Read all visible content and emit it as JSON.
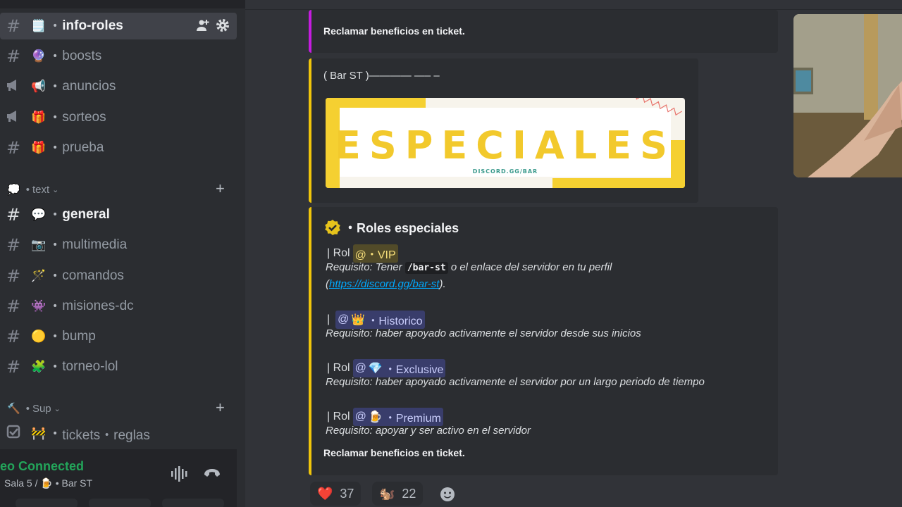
{
  "sidebar": {
    "channels_top": [
      {
        "label": "info-roles",
        "emoji": "🗒️",
        "icon": "hash",
        "active": true
      },
      {
        "label": "boosts",
        "emoji": "🔮",
        "icon": "hash"
      },
      {
        "label": "anuncios",
        "emoji": "📢",
        "icon": "megaphone"
      },
      {
        "label": "sorteos",
        "emoji": "🎁",
        "icon": "megaphone"
      },
      {
        "label": "prueba",
        "emoji": "🎁",
        "icon": "hash-thread"
      }
    ],
    "category_text": {
      "emoji": "💭",
      "label": "text"
    },
    "channels_text": [
      {
        "label": "general",
        "emoji": "💬",
        "icon": "hash",
        "bold": true
      },
      {
        "label": "multimedia",
        "emoji": "📷",
        "icon": "hash"
      },
      {
        "label": "comandos",
        "emoji": "🪄",
        "icon": "hash"
      },
      {
        "label": "misiones-dc",
        "emoji": "👾",
        "icon": "hash"
      },
      {
        "label": "bump",
        "emoji": "🟡",
        "icon": "hash-thread"
      },
      {
        "label": "torneo-lol",
        "emoji": "🧩",
        "icon": "hash-thread"
      }
    ],
    "category_sup": {
      "emoji": "🔨",
      "label": "Sup"
    },
    "channel_tickets": {
      "label": "tickets・reglas",
      "emoji": "🚧",
      "icon": "checkbox"
    },
    "voice": {
      "status": "eo Connected",
      "location": "Sala 5 /",
      "server": "Bar ST",
      "server_emoji": "🍺"
    }
  },
  "messages": {
    "top_embed_footer": "Reclamar beneficios en ticket.",
    "bar_embed_title": "( Bar ST )———— —– –",
    "banner": {
      "title": "ESPECIALES",
      "sub": "DISCORD.GG/BAR"
    },
    "roles_embed": {
      "title": "・Roles especiales",
      "title_emoji": "✅",
      "rol_word": "| Rol",
      "bar_only": "|",
      "vip": {
        "mention": "@・VIP",
        "req_pre": "Requisito: Tener",
        "req_code": "/bar-st",
        "req_post": "o el enlace del servidor en tu perfil",
        "link_open": "(",
        "link": "https://discord.gg/bar-st",
        "link_close": ")."
      },
      "historico": {
        "mention_emoji": "👑",
        "mention": "・Historico",
        "req": "Requisito: haber apoyado activamente el servidor desde sus inicios"
      },
      "exclusive": {
        "mention_emoji": "💎",
        "mention": "・Exclusive",
        "req": "Requisito: haber apoyado activamente el servidor por un largo periodo de tiempo"
      },
      "premium": {
        "mention_emoji": "🍺",
        "mention": "・Premium",
        "req": "Requisito: apoyar y ser activo en el servidor"
      },
      "footer": "Reclamar beneficios en ticket.",
      "at": "@"
    },
    "reactions": [
      {
        "emoji": "❤️",
        "count": "37"
      },
      {
        "emoji": "🐿️",
        "count": "22"
      }
    ]
  },
  "colors": {
    "accent_yellow": "#f0c50b",
    "accent_pink": "#c51ce0",
    "connected_green": "#23a55a"
  }
}
